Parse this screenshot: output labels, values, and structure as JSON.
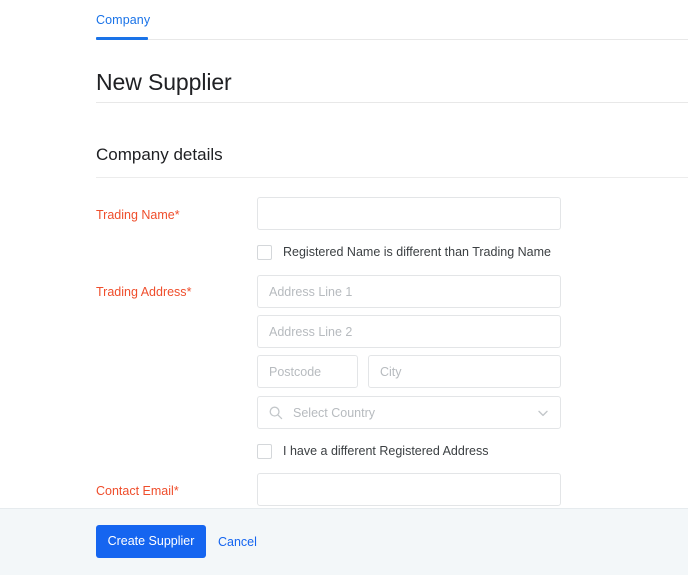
{
  "tabs": {
    "items": [
      {
        "label": "Company",
        "active": true
      }
    ]
  },
  "page": {
    "title": "New Supplier"
  },
  "section": {
    "title": "Company details"
  },
  "form": {
    "trading_name": {
      "label": "Trading Name",
      "required_marker": "*",
      "value": "",
      "placeholder": ""
    },
    "registered_name_checkbox": {
      "label": "Registered Name is different than Trading Name",
      "checked": false
    },
    "trading_address": {
      "label": "Trading Address",
      "required_marker": "*",
      "line1": {
        "value": "",
        "placeholder": "Address Line 1"
      },
      "line2": {
        "value": "",
        "placeholder": "Address Line 2"
      },
      "postcode": {
        "value": "",
        "placeholder": "Postcode"
      },
      "city": {
        "value": "",
        "placeholder": "City"
      },
      "country": {
        "value": "",
        "placeholder": "Select Country",
        "search_icon": "search-icon",
        "dropdown_icon": "chevron-down-icon"
      }
    },
    "registered_address_checkbox": {
      "label": "I have a different Registered Address",
      "checked": false
    },
    "contact_email": {
      "label": "Contact Email",
      "required_marker": "*",
      "value": "",
      "placeholder": ""
    }
  },
  "footer": {
    "submit_label": "Create Supplier",
    "cancel_label": "Cancel"
  },
  "colors": {
    "accent_blue": "#1a73e8",
    "button_blue": "#1565f0",
    "required_label": "#ef4e2c",
    "footer_bg": "#f3f7f9",
    "border": "#e3e5e7",
    "placeholder": "#b7bbbf"
  }
}
